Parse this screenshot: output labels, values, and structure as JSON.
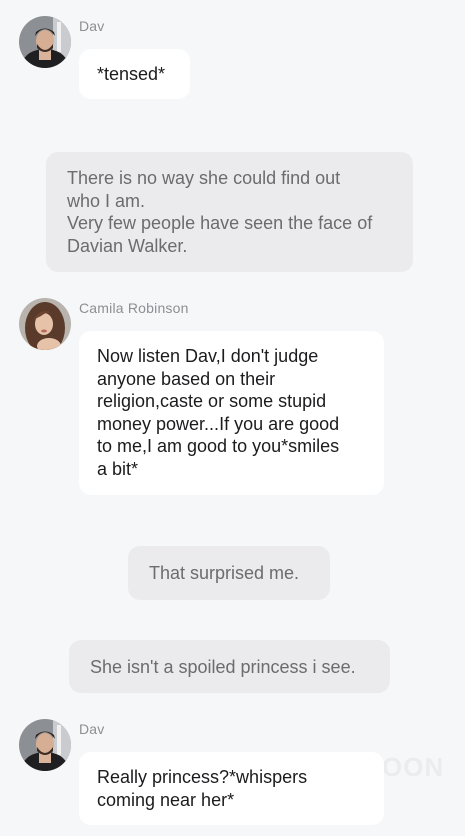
{
  "messages": [
    {
      "type": "character",
      "speaker": "Dav",
      "avatar": "dav-avatar",
      "lines": [
        "*tensed*"
      ]
    },
    {
      "type": "narration",
      "lines": [
        "There is no way she could find out",
        "who I am.",
        "Very few people have seen the face of",
        "Davian Walker."
      ]
    },
    {
      "type": "character",
      "speaker": "Camila Robinson",
      "avatar": "camila-avatar",
      "lines": [
        "Now listen Dav,I don't judge",
        "anyone based on their",
        "religion,caste or some stupid",
        "money power...If you are good",
        "to me,I am good to you*smiles",
        "a bit*"
      ]
    },
    {
      "type": "narration",
      "lines": [
        "That surprised me."
      ]
    },
    {
      "type": "narration",
      "lines": [
        "She isn't a spoiled princess i see."
      ]
    },
    {
      "type": "character",
      "speaker": "Dav",
      "avatar": "dav-avatar",
      "lines": [
        "Really princess?*whispers",
        "coming near her*"
      ]
    }
  ],
  "watermark": "OON",
  "colors": {
    "background": "#f6f7f9",
    "character_bubble": "#ffffff",
    "narration_bubble": "#ebebed",
    "speaker_name": "#8e8e93"
  }
}
